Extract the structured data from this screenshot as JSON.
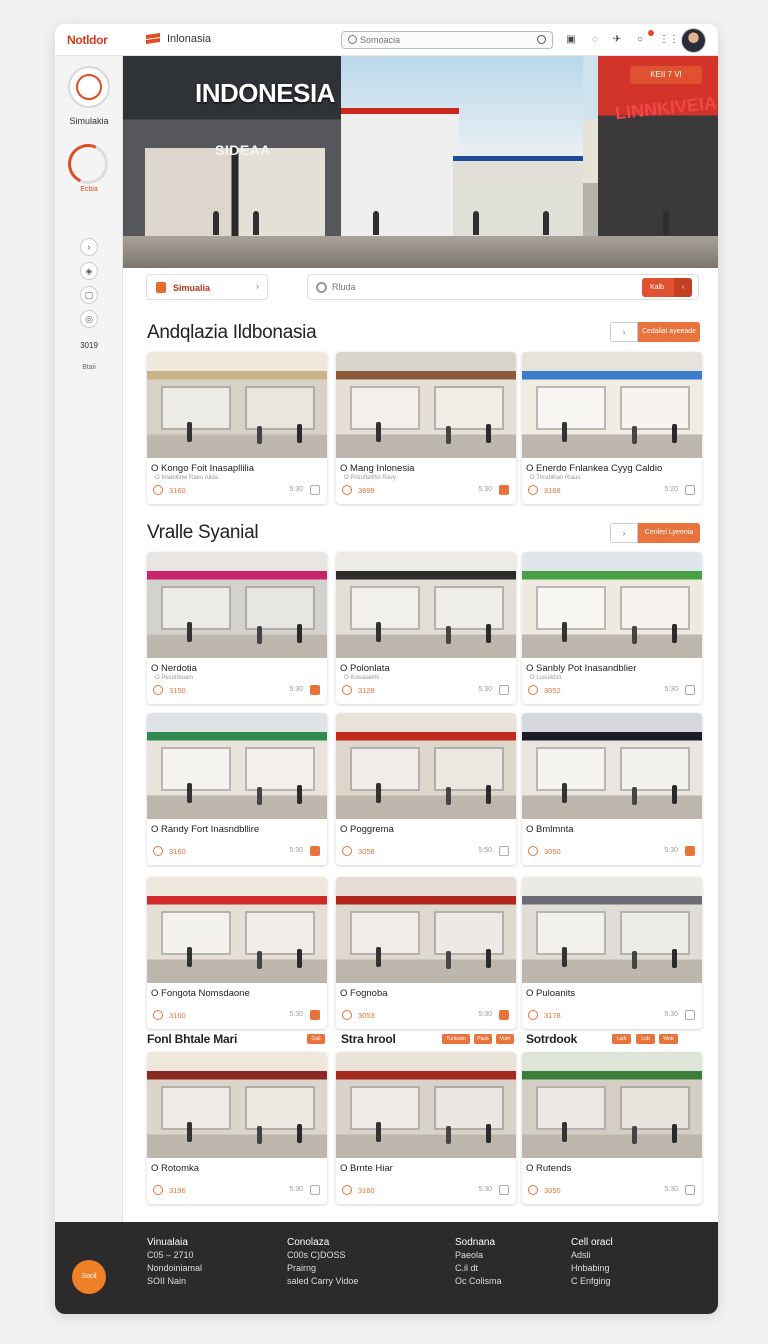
{
  "topbar": {
    "logo": "Notldor",
    "brand": "Inlonasia",
    "search_placeholder": "Somoacia",
    "icons": [
      "calendar-icon",
      "refresh-icon",
      "share-icon",
      "bell-icon",
      "grid-icon"
    ]
  },
  "sidebar": {
    "app_name": "Simulakia",
    "gauge_label": "Ecbia",
    "icons": [
      "chevron-icon",
      "shield-icon",
      "tablet-icon",
      "fingerprint-icon"
    ],
    "year": "3019",
    "more": "Btaii"
  },
  "hero": {
    "title": "INDONESIA",
    "sign_left": "SIDEAA",
    "sign_right": "LINNKIVEIA",
    "badge": "KEII 7 VI"
  },
  "filter": {
    "chip_label": "Simualia",
    "search_placeholder": "Rluda",
    "go_label": "Kalb"
  },
  "sections": [
    {
      "title": "Andqlazia Ildbonasia",
      "view_label": "Cedalial ayeeade",
      "cards": [
        {
          "name": "O Kongo Foit Inasapllilia",
          "sub": "O Inlabiliinw Raeu Alida",
          "price": "3160",
          "rating": "5:30",
          "saved": false
        },
        {
          "name": "O Mang Inlonesia",
          "sub": "O Pricuflallifoi Ravy",
          "price": "3699",
          "rating": "5:30",
          "saved": true
        },
        {
          "name": "O Enerdo Fnlankea Cyyg Caldio",
          "sub": "O Thrabihan Rlaus",
          "price": "3168",
          "rating": "5:20",
          "saved": false
        }
      ]
    },
    {
      "title": "Vralle Syanial",
      "view_label": "Cenleri Lyeenia",
      "cards": [
        {
          "name": "O Nerdotia",
          "sub": "O Pesuhbuain",
          "price": "3150",
          "rating": "5:30",
          "saved": true
        },
        {
          "name": "O Polonlata",
          "sub": "O Koisalaikhi",
          "price": "3128",
          "rating": "5:30",
          "saved": false
        },
        {
          "name": "O Sanbly Pot Inasandblier",
          "sub": "O Lusuildsli",
          "price": "3052",
          "rating": "5:30",
          "saved": false
        }
      ]
    }
  ],
  "grid_rows": [
    [
      {
        "name": "O Randy Fort Inasndbllire",
        "sub": "",
        "price": "3160",
        "rating": "5:30",
        "saved": true
      },
      {
        "name": "O Poggrema",
        "sub": "",
        "price": "3058",
        "rating": "5:50",
        "saved": false
      },
      {
        "name": "O Bmlmnta",
        "sub": "",
        "price": "3050",
        "rating": "5:30",
        "saved": true
      }
    ],
    [
      {
        "name": "O Fongota Nomsdaone",
        "sub": "",
        "price": "3160",
        "rating": "5:30",
        "saved": true
      },
      {
        "name": "O Fognoba",
        "sub": "",
        "price": "3053",
        "rating": "5:30",
        "saved": true
      },
      {
        "name": "O Puloanits",
        "sub": "",
        "price": "3178",
        "rating": "5:30",
        "saved": false
      }
    ]
  ],
  "mini_sections": [
    {
      "title": "Fonl Bhtale Mari",
      "tags": [
        "Gall"
      ]
    },
    {
      "title": "Stra hrool",
      "tags": [
        "Tunbutio",
        "Pasb",
        "Vurh"
      ]
    },
    {
      "title": "Sotrdook",
      "tags": [
        "Lath",
        "Lob",
        "Wob"
      ]
    }
  ],
  "last_row": [
    {
      "name": "O Rotomka",
      "sub": "",
      "price": "3196",
      "rating": "5:30",
      "saved": false
    },
    {
      "name": "O Brnte Hiar",
      "sub": "",
      "price": "3160",
      "rating": "5:30",
      "saved": false
    },
    {
      "name": "O Rutends",
      "sub": "",
      "price": "3050",
      "rating": "5:30",
      "saved": false
    }
  ],
  "footer": {
    "orb_label": "Socil",
    "columns": [
      {
        "heading": "Vinualaia",
        "lines": [
          "C05 – 2710",
          "Nondoiniamal",
          "SOII Nain"
        ]
      },
      {
        "heading": "Conolaza",
        "lines": [
          "C00s C)DOSS",
          "Prairng",
          "saled Carry Vidoe"
        ]
      },
      {
        "heading": "Sodnana",
        "lines": [
          "Paeola",
          "C.il dt",
          "Oc Colisma"
        ]
      },
      {
        "heading": "Cell oracl",
        "lines": [
          "Adsli",
          "Hnbabing",
          "C Enfging"
        ]
      }
    ]
  }
}
